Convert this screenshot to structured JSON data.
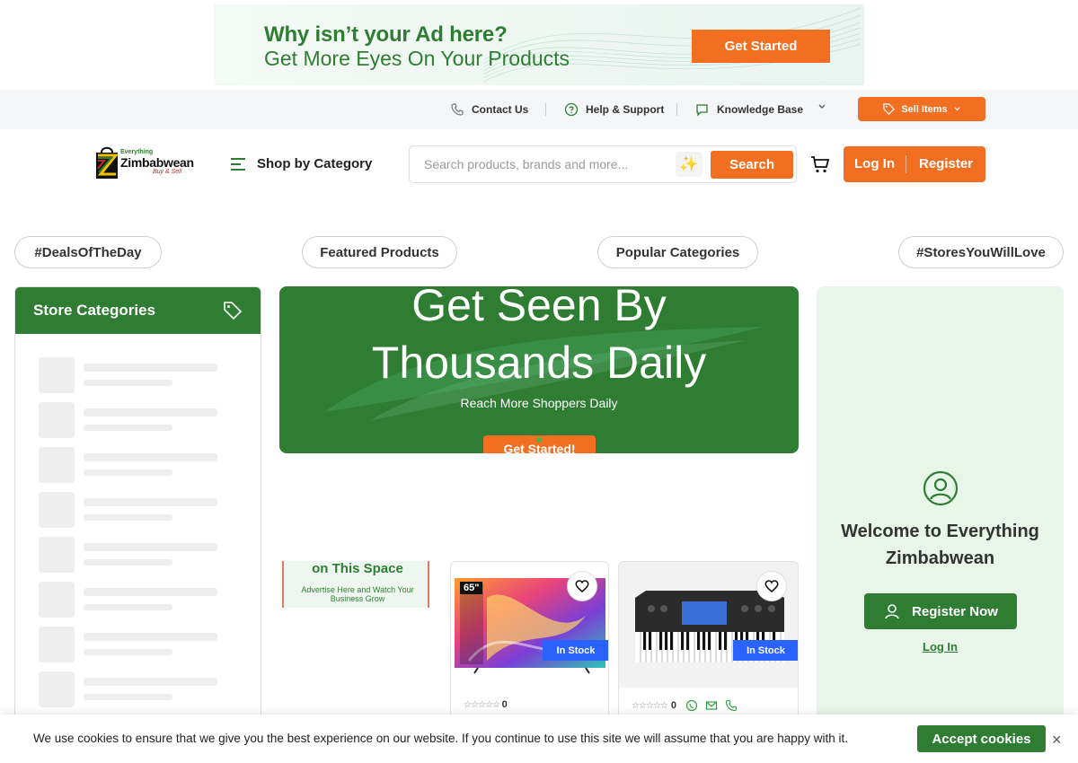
{
  "ad_banner": {
    "headline": "Why isn’t your Ad here?",
    "subline": "Get More Eyes On Your Products",
    "cta": "Get Started"
  },
  "utility_bar": {
    "contact": "Contact Us",
    "help": "Help & Support",
    "knowledge": "Knowledge Base",
    "sell": "Sell Items"
  },
  "header": {
    "logo_small": "Everything",
    "logo_main": "Zimbabwean",
    "logo_tag": "Buy & Sell",
    "shop_by_category": "Shop by Category",
    "search_placeholder": "Search products, brands and more...",
    "search_button": "Search",
    "login": "Log In",
    "register": "Register"
  },
  "pills": [
    "#DealsOfTheDay",
    "Featured Products",
    "Popular Categories",
    "#StoresYouWillLove"
  ],
  "store_categories": {
    "title": "Store Categories"
  },
  "hero": {
    "line1": "Get Seen By",
    "line2": "Thousands Daily",
    "subtitle": "Reach More Shoppers Daily",
    "cta": "Get Started!"
  },
  "small_ad": {
    "title": "on This Space",
    "subtitle": "Advertise Here and Watch Your Business Grow"
  },
  "products": [
    {
      "badge": "In Stock",
      "rating_count": "0",
      "tv_size": "65\""
    },
    {
      "badge": "In Stock",
      "rating_count": "0"
    }
  ],
  "welcome": {
    "title": "Welcome to Everything Zimbabwean",
    "register_button": "Register Now",
    "login_link": "Log In"
  },
  "cookie": {
    "text": "We use cookies to ensure that we give you the best experience on our website. If you continue to use this site we will assume that you are happy with it.",
    "accept": "Accept cookies",
    "close": "×"
  },
  "colors": {
    "brand_green": "#2f7d32",
    "brand_orange": "#f26f21",
    "badge_blue": "#2962ff"
  }
}
